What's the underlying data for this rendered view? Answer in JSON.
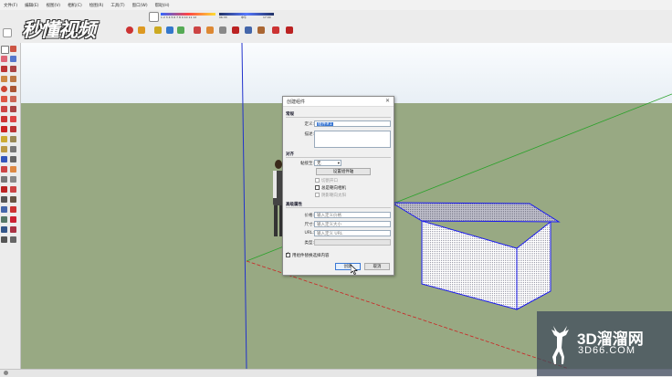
{
  "menubar": {
    "items": [
      "文件(F)",
      "编辑(E)",
      "视图(V)",
      "相机(C)",
      "绘图(R)",
      "工具(T)",
      "窗口(W)",
      "帮助(H)"
    ]
  },
  "watermark": {
    "top_text": "秒懂视频",
    "brand": "3D溜溜网",
    "site": "3D66.COM"
  },
  "shadow_bar": {
    "months": "1 2 3 4 5 6 7 8 9 10 11 12",
    "time_start": "06:33",
    "time_mid": "中午",
    "time_end": "17:00"
  },
  "dialog": {
    "title": "创建组件",
    "section_general": "常规",
    "name_label": "定义:",
    "name_value": "组件#1",
    "desc_label": "描述:",
    "section_align": "对齐",
    "glue_label": "黏接至:",
    "glue_value": "无",
    "set_plane_button": "设置组件轴",
    "cut_opening": "切割开口",
    "always_face_camera": "总是朝向相机",
    "shadows_face_sun": "阴影朝向太阳",
    "section_advanced": "高级属性",
    "price_label": "价格:",
    "price_placeholder": "输入定义价格",
    "size_label": "尺寸:",
    "size_placeholder": "输入定义大小",
    "url_label": "URL:",
    "url_placeholder": "输入定义 URL",
    "type_label": "类型:",
    "replace_selection": "用组件替换选择内容",
    "create_button": "创建",
    "cancel_button": "取消"
  },
  "colors": {
    "ground": "#98a983",
    "axis_blue": "#2233cc",
    "axis_green": "#2aa22a",
    "axis_red": "#cc2222",
    "selection": "#1a1aee"
  }
}
